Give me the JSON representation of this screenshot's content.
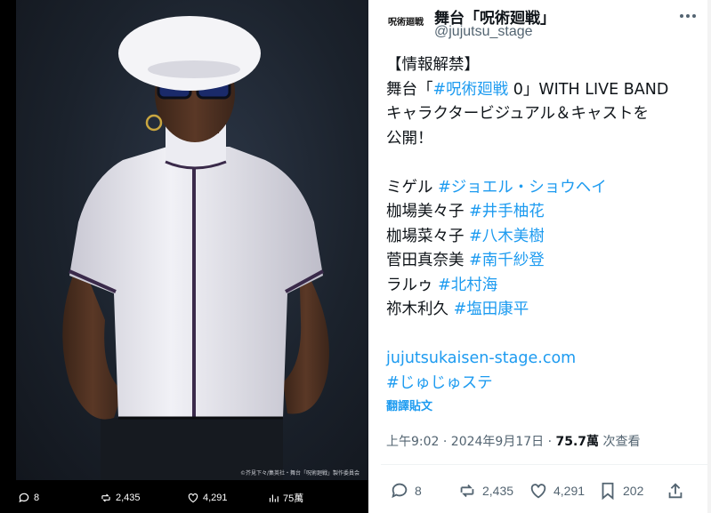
{
  "media": {
    "copyright": "©芥見下々/集英社・舞台「呪術廻戦」製作委員会",
    "stats": {
      "replies": "8",
      "reposts": "2,435",
      "likes": "4,291",
      "views": "75萬"
    }
  },
  "tweet": {
    "avatar_text": "呪術廻戦",
    "display_name": "舞台「呪術廻戦」",
    "handle": "@jujutsu_stage",
    "body": {
      "l1": "【情報解禁】",
      "l2_a": "舞台「",
      "l2_link": "#呪術廻戦",
      "l2_b": " 0」WITH LIVE BAND",
      "l3": "キャラクタービジュアル＆キャストを",
      "l4": "公開！",
      "cast": [
        {
          "role": "ミゲル ",
          "tag": "#ジョエル・ショウヘイ"
        },
        {
          "role": "枷場美々子 ",
          "tag": "#井手柚花"
        },
        {
          "role": "枷場菜々子 ",
          "tag": "#八木美樹"
        },
        {
          "role": "菅田真奈美 ",
          "tag": "#南千紗登"
        },
        {
          "role": "ラルゥ ",
          "tag": "#北村海"
        },
        {
          "role": "祢木利久 ",
          "tag": "#塩田康平"
        }
      ],
      "url": "jujutsukaisen-stage.com",
      "hashtag": "#じゅじゅステ"
    },
    "translate": "翻譯貼文",
    "meta": {
      "time_date": "上午9:02 · 2024年9月17日 · ",
      "views_num": "75.7萬",
      "views_label": " 次查看"
    },
    "actions": {
      "replies": "8",
      "reposts": "2,435",
      "likes": "4,291",
      "bookmarks": "202"
    }
  }
}
